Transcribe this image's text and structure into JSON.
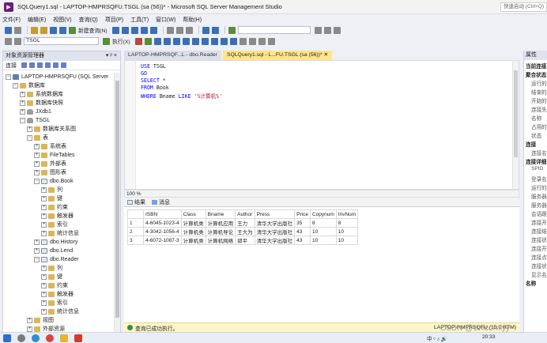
{
  "window": {
    "title": "SQLQuery1.sql - LAPTOP-HMPRSQFU.TSGL (sa (56))* - Microsoft SQL Server Management Studio",
    "quick_launch": "快速启动 (Ctrl+Q)"
  },
  "menu": [
    "文件(F)",
    "编辑(E)",
    "视图(V)",
    "查询(Q)",
    "项目(P)",
    "工具(T)",
    "窗口(W)",
    "帮助(H)"
  ],
  "toolbar": {
    "new_query": "新建查询(N)",
    "database": "TSGL",
    "execute": "执行(X)"
  },
  "object_explorer": {
    "title": "对象资源管理器",
    "title_pin": "▾ ᵖ ×",
    "connect": "连接",
    "tree": [
      {
        "level": 0,
        "label": "LAPTOP-HMPRSQFU (SQL Server",
        "icon": "server-icon",
        "expander": "−"
      },
      {
        "level": 1,
        "label": "数据库",
        "icon": "folder-icon",
        "expander": "−"
      },
      {
        "level": 2,
        "label": "系统数据库",
        "icon": "folder-icon",
        "expander": "+"
      },
      {
        "level": 2,
        "label": "数据库快照",
        "icon": "folder-icon",
        "expander": "+"
      },
      {
        "level": 2,
        "label": "JXdb1",
        "icon": "database-icon",
        "expander": "+"
      },
      {
        "level": 2,
        "label": "TSGL",
        "icon": "database-icon",
        "expander": "−"
      },
      {
        "level": 3,
        "label": "数据库关系图",
        "icon": "folder-icon",
        "expander": "+"
      },
      {
        "level": 3,
        "label": "表",
        "icon": "folder-icon",
        "expander": "−"
      },
      {
        "level": 4,
        "label": "系统表",
        "icon": "folder-icon",
        "expander": "+"
      },
      {
        "level": 4,
        "label": "FileTables",
        "icon": "folder-icon",
        "expander": "+"
      },
      {
        "level": 4,
        "label": "外部表",
        "icon": "folder-icon",
        "expander": "+"
      },
      {
        "level": 4,
        "label": "图形表",
        "icon": "folder-icon",
        "expander": "+"
      },
      {
        "level": 4,
        "label": "dbo.Book",
        "icon": "table-icon",
        "expander": "−"
      },
      {
        "level": 5,
        "label": "列",
        "icon": "folder-icon",
        "expander": "+"
      },
      {
        "level": 5,
        "label": "键",
        "icon": "folder-icon",
        "expander": "+"
      },
      {
        "level": 5,
        "label": "约束",
        "icon": "folder-icon",
        "expander": "+"
      },
      {
        "level": 5,
        "label": "触发器",
        "icon": "folder-icon",
        "expander": "+"
      },
      {
        "level": 5,
        "label": "索引",
        "icon": "folder-icon",
        "expander": "+"
      },
      {
        "level": 5,
        "label": "统计信息",
        "icon": "folder-icon",
        "expander": "+"
      },
      {
        "level": 4,
        "label": "dbo.History",
        "icon": "table-icon",
        "expander": "+"
      },
      {
        "level": 4,
        "label": "dbo.Lend",
        "icon": "table-icon",
        "expander": "+"
      },
      {
        "level": 4,
        "label": "dbo.Reader",
        "icon": "table-icon",
        "expander": "−"
      },
      {
        "level": 5,
        "label": "列",
        "icon": "folder-icon",
        "expander": "+"
      },
      {
        "level": 5,
        "label": "键",
        "icon": "folder-icon",
        "expander": "+"
      },
      {
        "level": 5,
        "label": "约束",
        "icon": "folder-icon",
        "expander": "+"
      },
      {
        "level": 5,
        "label": "触发器",
        "icon": "folder-icon",
        "expander": "+"
      },
      {
        "level": 5,
        "label": "索引",
        "icon": "folder-icon",
        "expander": "+"
      },
      {
        "level": 5,
        "label": "统计信息",
        "icon": "folder-icon",
        "expander": "+"
      },
      {
        "level": 3,
        "label": "视图",
        "icon": "folder-icon",
        "expander": "+"
      },
      {
        "level": 3,
        "label": "外部资源",
        "icon": "folder-icon",
        "expander": "+"
      },
      {
        "level": 3,
        "label": "同义词",
        "icon": "folder-icon",
        "expander": "+"
      }
    ]
  },
  "tabs": [
    {
      "label": "LAPTOP-HMPRSQF...L - dbo.Reader",
      "active": false
    },
    {
      "label": "SQLQuery1.sql - L...FU.TSGL (sa (56))*  ✕",
      "active": true
    }
  ],
  "editor": {
    "lines": [
      [
        {
          "t": "USE ",
          "c": "kw"
        },
        {
          "t": "TSGL",
          "c": "idn"
        }
      ],
      [
        {
          "t": "GO",
          "c": "kw"
        }
      ],
      [
        {
          "t": "SELECT ",
          "c": "kw"
        },
        {
          "t": "*",
          "c": "idn"
        }
      ],
      [
        {
          "t": "FROM ",
          "c": "kw"
        },
        {
          "t": "Book",
          "c": "idn"
        }
      ],
      [
        {
          "t": "WHERE ",
          "c": "kw"
        },
        {
          "t": "Bname ",
          "c": "idn"
        },
        {
          "t": "LIKE ",
          "c": "kw"
        },
        {
          "t": "'%计算机%'",
          "c": "str"
        }
      ]
    ],
    "zoom": "100 %"
  },
  "results": {
    "tab_results": "结果",
    "tab_messages": "消息",
    "columns": [
      "ISBN",
      "Class",
      "Bname",
      "Author",
      "Press",
      "Price",
      "Copynum",
      "InvNum"
    ],
    "rows": [
      [
        "1",
        "4-6045-1023-4",
        "计算机类",
        "计算机应用",
        "王力",
        "清华大学出版社",
        "35",
        "8",
        "8"
      ],
      [
        "2",
        "4-3042-1056-4",
        "计算机类",
        "计算机导论",
        "王大为",
        "清华大学出版社",
        "43",
        "10",
        "10"
      ],
      [
        "3",
        "4-6072-1087-3",
        "计算机类",
        "计算机网络",
        "郭平",
        "清华大学出版社",
        "43",
        "10",
        "10"
      ]
    ]
  },
  "status": {
    "message": "查询已成功执行。",
    "server": "LAPTOP-HMPRSQFU (15.0 RTM)"
  },
  "properties": {
    "title": "属性",
    "rows": [
      {
        "label": "当前连接",
        "header": true
      },
      {
        "label": "聚合状态",
        "header": true
      },
      {
        "label": "运行的",
        "header": false
      },
      {
        "label": "结束的",
        "header": false
      },
      {
        "label": "开始的",
        "header": false
      },
      {
        "label": "连接失败",
        "header": false
      },
      {
        "label": "名称",
        "header": false
      },
      {
        "label": "占用的",
        "header": false
      },
      {
        "label": "状态",
        "header": false
      },
      {
        "label": "连接",
        "header": true
      },
      {
        "label": "连接名",
        "header": false
      },
      {
        "label": "连接详细",
        "header": true
      },
      {
        "label": "SPID",
        "header": false
      },
      {
        "label": "登录名",
        "header": false
      },
      {
        "label": "运行的",
        "header": false
      },
      {
        "label": "服务器",
        "header": false
      },
      {
        "label": "服务器",
        "header": false
      },
      {
        "label": "会话跟",
        "header": false
      },
      {
        "label": "连接开",
        "header": false
      },
      {
        "label": "连接结",
        "header": false
      },
      {
        "label": "连接状",
        "header": false
      },
      {
        "label": "连接开",
        "header": false
      },
      {
        "label": "连接点",
        "header": false
      },
      {
        "label": "连接状",
        "header": false
      },
      {
        "label": "显示名",
        "header": false
      },
      {
        "label": "名称",
        "header": true
      }
    ]
  },
  "taskbar": {
    "tray": "中 ᶜ ♪ 🔊",
    "clock": "20:33"
  },
  "watermark": "CSDN @Unicornlyy"
}
